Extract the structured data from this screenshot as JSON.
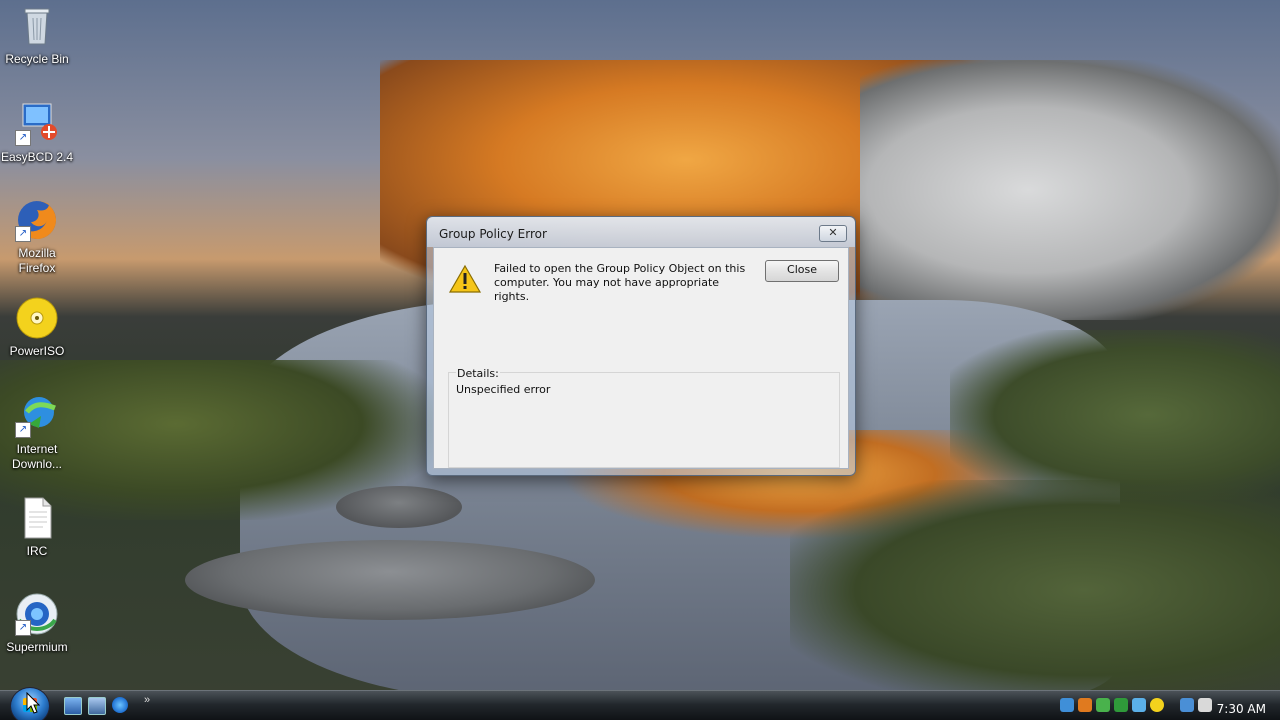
{
  "desktop": {
    "icons": [
      {
        "label": "Recycle Bin",
        "icon": "recycle-bin-icon"
      },
      {
        "label": "EasyBCD 2.4",
        "icon": "easybcd-icon"
      },
      {
        "label": "Mozilla Firefox",
        "icon": "firefox-icon"
      },
      {
        "label": "PowerISO",
        "icon": "poweriso-icon"
      },
      {
        "label": "Internet Downlo...",
        "icon": "internet-download-manager-icon"
      },
      {
        "label": "IRC",
        "icon": "text-document-icon"
      },
      {
        "label": "Supermium",
        "icon": "supermium-icon"
      }
    ]
  },
  "dialog": {
    "title": "Group Policy Error",
    "close_x": "✕",
    "icon": "warning-icon",
    "message": "Failed to open the Group Policy Object on this computer.  You may not have appropriate rights.",
    "close_button": "Close",
    "details_label": "Details:",
    "details_text": "Unspecified error"
  },
  "taskbar": {
    "quick_launch": [
      "show-desktop-icon",
      "switch-windows-icon",
      "internet-explorer-icon"
    ],
    "chevron": "»",
    "tray_icons": [
      "network-icon",
      "security-icon",
      "sync-icon",
      "update-icon",
      "tool-icon",
      "drive-icon",
      "display-icon",
      "volume-muted-icon"
    ],
    "clock": "7:30 AM"
  }
}
